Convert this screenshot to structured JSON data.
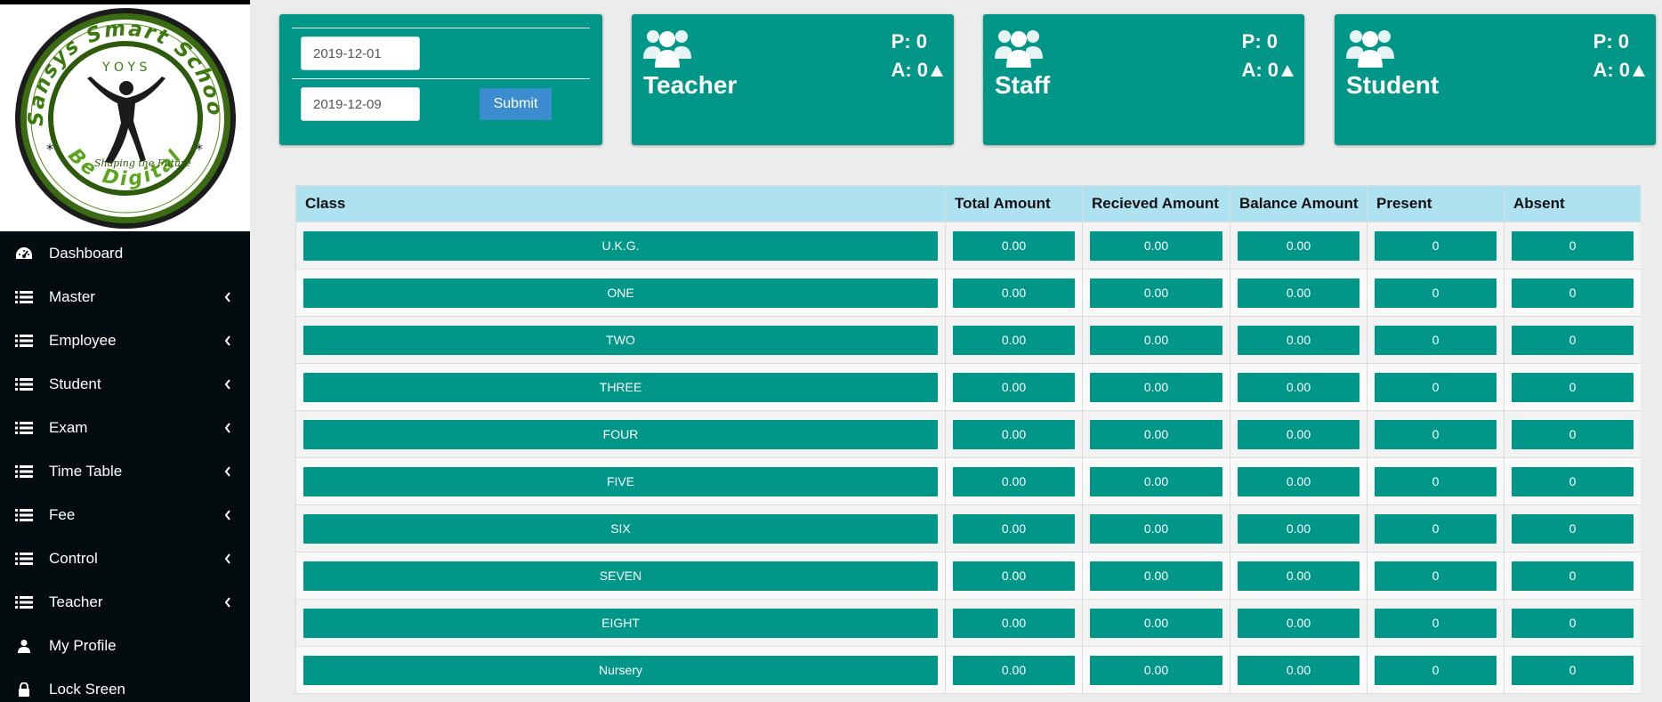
{
  "logo": {
    "ring_text_top": "Sansys Smart School",
    "ring_text_bottom": "Be Digital",
    "tagline": "Shaping the Future"
  },
  "sidebar": {
    "items": [
      {
        "label": "Dashboard",
        "icon": "dashboard-icon",
        "has_submenu": false
      },
      {
        "label": "Master",
        "icon": "list-icon",
        "has_submenu": true
      },
      {
        "label": "Employee",
        "icon": "list-icon",
        "has_submenu": true
      },
      {
        "label": "Student",
        "icon": "list-icon",
        "has_submenu": true
      },
      {
        "label": "Exam",
        "icon": "list-icon",
        "has_submenu": true
      },
      {
        "label": "Time Table",
        "icon": "list-icon",
        "has_submenu": true
      },
      {
        "label": "Fee",
        "icon": "list-icon",
        "has_submenu": true
      },
      {
        "label": "Control",
        "icon": "list-icon",
        "has_submenu": true
      },
      {
        "label": "Teacher",
        "icon": "list-icon",
        "has_submenu": true
      },
      {
        "label": "My Profile",
        "icon": "user-icon",
        "has_submenu": false
      },
      {
        "label": "Lock Sreen",
        "icon": "lock-icon",
        "has_submenu": false
      }
    ]
  },
  "date_filter": {
    "from_value": "2019-12-01",
    "to_value": "2019-12-09",
    "submit_label": "Submit"
  },
  "stats": [
    {
      "title": "Teacher",
      "present": "P: 0",
      "absent": "A: 0"
    },
    {
      "title": "Staff",
      "present": "P: 0",
      "absent": "A: 0"
    },
    {
      "title": "Student",
      "present": "P: 0",
      "absent": "A: 0"
    }
  ],
  "table": {
    "headers": [
      "Class",
      "Total Amount",
      "Recieved Amount",
      "Balance Amount",
      "Present",
      "Absent"
    ],
    "rows": [
      [
        "U.K.G.",
        "0.00",
        "0.00",
        "0.00",
        "0",
        "0"
      ],
      [
        "ONE",
        "0.00",
        "0.00",
        "0.00",
        "0",
        "0"
      ],
      [
        "TWO",
        "0.00",
        "0.00",
        "0.00",
        "0",
        "0"
      ],
      [
        "THREE",
        "0.00",
        "0.00",
        "0.00",
        "0",
        "0"
      ],
      [
        "FOUR",
        "0.00",
        "0.00",
        "0.00",
        "0",
        "0"
      ],
      [
        "FIVE",
        "0.00",
        "0.00",
        "0.00",
        "0",
        "0"
      ],
      [
        "SIX",
        "0.00",
        "0.00",
        "0.00",
        "0",
        "0"
      ],
      [
        "SEVEN",
        "0.00",
        "0.00",
        "0.00",
        "0",
        "0"
      ],
      [
        "EIGHT",
        "0.00",
        "0.00",
        "0.00",
        "0",
        "0"
      ],
      [
        "Nursery",
        "0.00",
        "0.00",
        "0.00",
        "0",
        "0"
      ]
    ]
  },
  "colors": {
    "teal": "#009688",
    "sidebar_bg": "#040c10",
    "table_header_bg": "#aee2f1",
    "submit_blue": "#3c8dd0"
  }
}
